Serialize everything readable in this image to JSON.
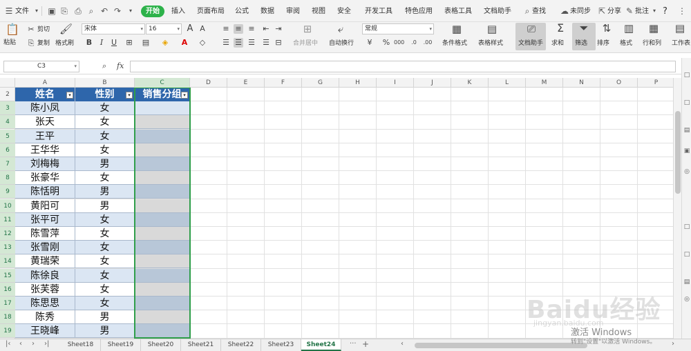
{
  "menubar": {
    "file": "文件",
    "start": "开始",
    "tabs": [
      "插入",
      "页面布局",
      "公式",
      "数据",
      "审阅",
      "视图",
      "安全",
      "开发工具",
      "特色应用",
      "表格工具",
      "文档助手"
    ],
    "search": "查找",
    "sync": "未同步",
    "share": "分享",
    "comment": "批注",
    "help": "?"
  },
  "ribbon": {
    "paste": "粘贴",
    "cut": "剪切",
    "copy": "复制",
    "format_painter": "格式刷",
    "font_name": "宋体",
    "font_size": "16",
    "merge_center": "合并居中",
    "wrap_text": "自动换行",
    "number_format": "常规",
    "conditional_format": "条件格式",
    "table_style": "表格样式",
    "doc_assistant": "文档助手",
    "sum": "求和",
    "filter": "筛选",
    "sort": "排序",
    "format": "格式",
    "row_col": "行和列",
    "worksheet": "工作表"
  },
  "formula_bar": {
    "name_box": "C3",
    "fx": "fx",
    "value": ""
  },
  "columns": [
    "A",
    "B",
    "C",
    "D",
    "E",
    "F",
    "G",
    "H",
    "I",
    "J",
    "K",
    "L",
    "M",
    "N",
    "O",
    "P"
  ],
  "rows": [
    "2",
    "3",
    "4",
    "5",
    "6",
    "7",
    "8",
    "9",
    "10",
    "11",
    "12",
    "13",
    "14",
    "15",
    "16",
    "17",
    "18",
    "19"
  ],
  "table": {
    "headers": [
      "姓名",
      "性别",
      "销售分组"
    ],
    "data": [
      [
        "陈小凤",
        "女",
        ""
      ],
      [
        "张天",
        "女",
        ""
      ],
      [
        "王平",
        "女",
        ""
      ],
      [
        "王华华",
        "女",
        ""
      ],
      [
        "刘梅梅",
        "男",
        ""
      ],
      [
        "张豪华",
        "女",
        ""
      ],
      [
        "陈恬明",
        "男",
        ""
      ],
      [
        "黄阳可",
        "男",
        ""
      ],
      [
        "张平可",
        "女",
        ""
      ],
      [
        "陈雪萍",
        "女",
        ""
      ],
      [
        "张雪刚",
        "女",
        ""
      ],
      [
        "黄瑞荣",
        "女",
        ""
      ],
      [
        "陈徐良",
        "女",
        ""
      ],
      [
        "张芙蓉",
        "女",
        ""
      ],
      [
        "陈思思",
        "女",
        ""
      ],
      [
        "陈秀",
        "男",
        ""
      ],
      [
        "王晓峰",
        "男",
        ""
      ]
    ]
  },
  "sheets": [
    "Sheet18",
    "Sheet19",
    "Sheet20",
    "Sheet21",
    "Sheet22",
    "Sheet23",
    "Sheet24"
  ],
  "active_sheet": "Sheet24",
  "colors": {
    "header_bg": "#2e66ab",
    "row_odd": "#dbe6f3",
    "row_even": "#ffffff",
    "c_odd": "#b8c7d8",
    "c_even": "#d9d9d9",
    "selection": "#2f9e4a"
  },
  "watermark": {
    "activate_line1": "激活 Windows",
    "activate_line2": "转到\"设置\"以激活 Windows。",
    "baidu": "Baidu经验",
    "baidu_url": "jingyan.baidu.com"
  }
}
